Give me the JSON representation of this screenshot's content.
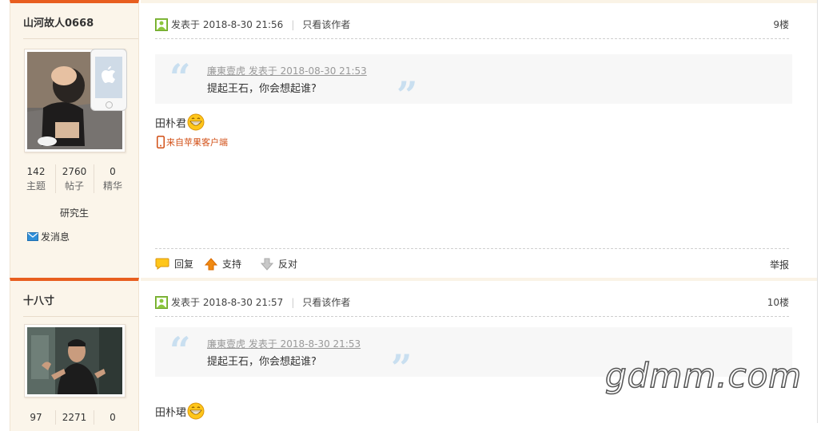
{
  "posts": [
    {
      "author": {
        "name": "山河故人0668",
        "stats": [
          {
            "num": "142",
            "label": "主题"
          },
          {
            "num": "2760",
            "label": "帖子"
          },
          {
            "num": "0",
            "label": "精华"
          }
        ],
        "rank": "研究生",
        "send_message": "发消息"
      },
      "posted": "发表于 2018-8-30 21:56",
      "only_author": "只看该作者",
      "floor": "9楼",
      "quote": {
        "head": "廉東壹虎 发表于 2018-08-30 21:53",
        "text": "提起王石，你会想起谁?"
      },
      "content": "田朴君",
      "client": "来自苹果客户端",
      "actions": {
        "reply": "回复",
        "support": "支持",
        "oppose": "反对",
        "report": "举报"
      }
    },
    {
      "author": {
        "name": "十八寸",
        "stats": [
          {
            "num": "97",
            "label": ""
          },
          {
            "num": "2271",
            "label": ""
          },
          {
            "num": "0",
            "label": ""
          }
        ]
      },
      "posted": "发表于 2018-8-30 21:57",
      "only_author": "只看该作者",
      "floor": "10楼",
      "quote": {
        "head": "廉東壹虎 发表于 2018-8-30 21:53",
        "text": "提起王石，你会想起谁?"
      },
      "content": "田朴珺"
    }
  ],
  "watermark": "gdmm.com",
  "colors": {
    "accent": "#e85e1f",
    "sidebar_bg": "#fbf5ea",
    "client_red": "#d24f16"
  }
}
